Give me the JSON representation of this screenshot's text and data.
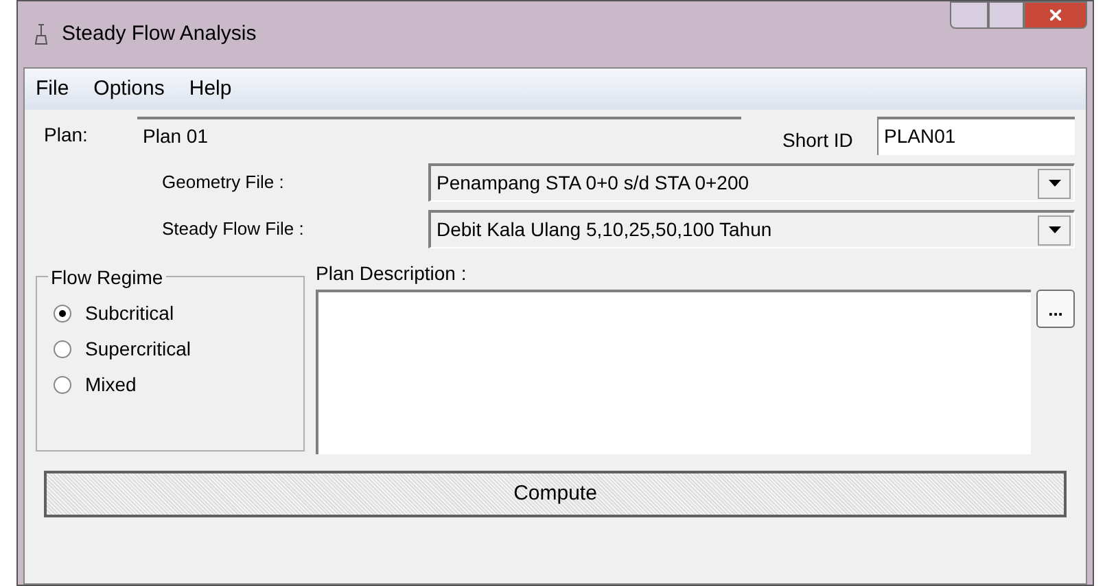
{
  "window": {
    "title": "Steady Flow Analysis"
  },
  "menu": [
    "File",
    "Options",
    "Help"
  ],
  "plan": {
    "label": "Plan:",
    "value": "Plan 01"
  },
  "short_id": {
    "label": "Short ID",
    "value": "PLAN01"
  },
  "geometry_file": {
    "label": "Geometry File :",
    "value": "Penampang STA 0+0 s/d STA 0+200"
  },
  "steady_flow_file": {
    "label": "Steady Flow File :",
    "value": "Debit Kala Ulang 5,10,25,50,100 Tahun"
  },
  "flow_regime": {
    "label": "Flow Regime",
    "options": [
      {
        "label": "Subcritical",
        "selected": true
      },
      {
        "label": "Supercritical",
        "selected": false
      },
      {
        "label": "Mixed",
        "selected": false
      }
    ]
  },
  "plan_description": {
    "label": "Plan Description :",
    "browse": "..."
  },
  "compute_button": "Compute"
}
